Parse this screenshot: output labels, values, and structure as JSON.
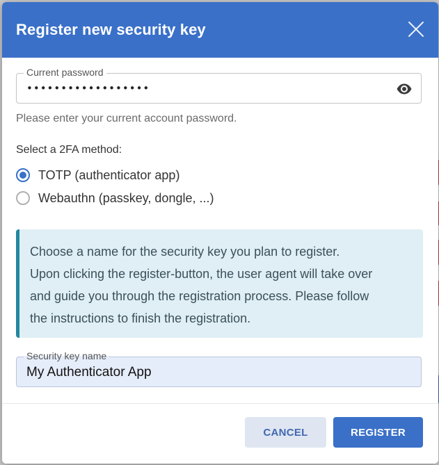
{
  "dialog": {
    "title": "Register new security key",
    "close_icon": "close-icon"
  },
  "password": {
    "label": "Current password",
    "value": "••••••••••••••••••",
    "helper": "Please enter your current account password.",
    "toggle_icon": "eye-icon"
  },
  "method": {
    "label": "Select a 2FA method:",
    "options": [
      {
        "label": "TOTP (authenticator app)",
        "checked": true
      },
      {
        "label": "Webauthn (passkey, dongle, ...)",
        "checked": false
      }
    ]
  },
  "info": {
    "lines": [
      "Choose a name for the security key you plan to register.",
      "Upon clicking the register-button, the user agent will take over",
      "and guide you through the registration process. Please follow",
      "the instructions to finish the registration."
    ]
  },
  "keyname": {
    "label": "Security key name",
    "value": "My Authenticator App"
  },
  "footer": {
    "cancel_label": "CANCEL",
    "register_label": "REGISTER"
  },
  "colors": {
    "primary": "#3a70c8",
    "info_bg": "#dfeff5",
    "info_accent": "#2487a0"
  }
}
